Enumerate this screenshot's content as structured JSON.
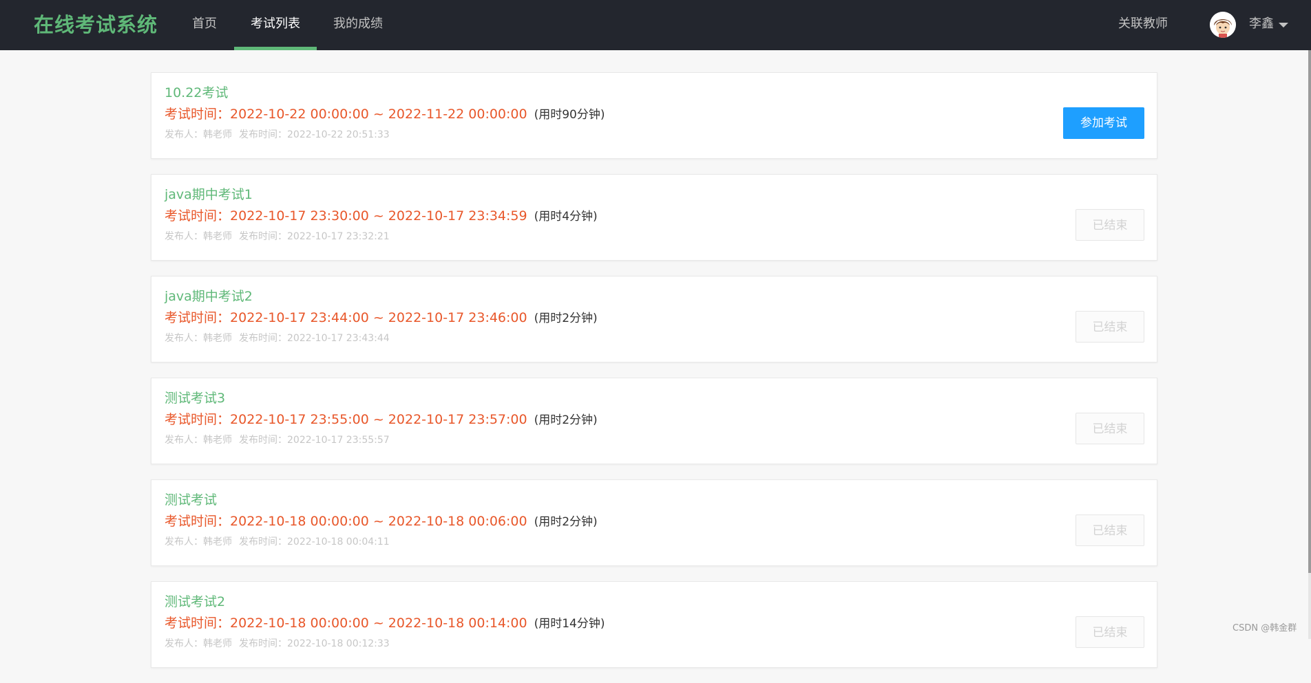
{
  "header": {
    "brand": "在线考试系统",
    "nav": [
      {
        "label": "首页",
        "active": false
      },
      {
        "label": "考试列表",
        "active": true
      },
      {
        "label": "我的成绩",
        "active": false
      }
    ],
    "related_teacher": "关联教师",
    "user_name": "李鑫",
    "accent_color": "#5fb878",
    "bg_color": "#23262e"
  },
  "exams": [
    {
      "title": "10.22考试",
      "time_prefix": "考试时间：",
      "time_range": "2022-10-22 00:00:00 ~ 2022-11-22 00:00:00",
      "duration": "(用时90分钟)",
      "publisher": "发布人：韩老师",
      "publish_time": "发布时间：2022-10-22 20:51:33",
      "button": "参加考试",
      "status": "open"
    },
    {
      "title": "java期中考试1",
      "time_prefix": "考试时间：",
      "time_range": "2022-10-17 23:30:00 ~ 2022-10-17 23:34:59",
      "duration": "(用时4分钟)",
      "publisher": "发布人：韩老师",
      "publish_time": "发布时间：2022-10-17 23:32:21",
      "button": "已结束",
      "status": "ended"
    },
    {
      "title": "java期中考试2",
      "time_prefix": "考试时间：",
      "time_range": "2022-10-17 23:44:00 ~ 2022-10-17 23:46:00",
      "duration": "(用时2分钟)",
      "publisher": "发布人：韩老师",
      "publish_time": "发布时间：2022-10-17 23:43:44",
      "button": "已结束",
      "status": "ended"
    },
    {
      "title": "测试考试3",
      "time_prefix": "考试时间：",
      "time_range": "2022-10-17 23:55:00 ~ 2022-10-17 23:57:00",
      "duration": "(用时2分钟)",
      "publisher": "发布人：韩老师",
      "publish_time": "发布时间：2022-10-17 23:55:57",
      "button": "已结束",
      "status": "ended"
    },
    {
      "title": "测试考试",
      "time_prefix": "考试时间：",
      "time_range": "2022-10-18 00:00:00 ~ 2022-10-18 00:06:00",
      "duration": "(用时2分钟)",
      "publisher": "发布人：韩老师",
      "publish_time": "发布时间：2022-10-18 00:04:11",
      "button": "已结束",
      "status": "ended"
    },
    {
      "title": "测试考试2",
      "time_prefix": "考试时间：",
      "time_range": "2022-10-18 00:00:00 ~ 2022-10-18 00:14:00",
      "duration": "(用时14分钟)",
      "publisher": "发布人：韩老师",
      "publish_time": "发布时间：2022-10-18 00:12:33",
      "button": "已结束",
      "status": "ended"
    }
  ],
  "watermark": "CSDN @韩金群"
}
